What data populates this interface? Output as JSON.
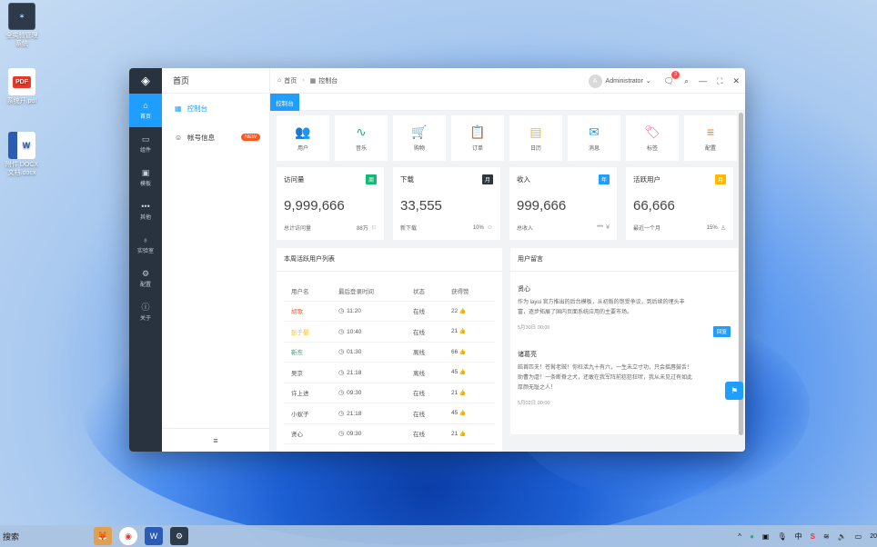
{
  "desktop": {
    "icons": [
      {
        "label_line1": "全实验管理",
        "label_line2": "系统",
        "badge": "✶"
      },
      {
        "label_line1": "系统开.pdf",
        "label_line2": "",
        "badge": "PDF"
      },
      {
        "label_line1": "附件 DOCX",
        "label_line2": "文档.docx",
        "badge": "W"
      }
    ]
  },
  "window": {
    "rail": [
      {
        "label": "首页",
        "icon": "home-icon",
        "glyph": "⌂",
        "active": true
      },
      {
        "label": "组件",
        "icon": "box-icon",
        "glyph": "▭"
      },
      {
        "label": "模板",
        "icon": "template-icon",
        "glyph": "▣"
      },
      {
        "label": "其他",
        "icon": "more-icon",
        "glyph": "•••"
      },
      {
        "label": "实验室",
        "icon": "flask-icon",
        "glyph": "♁"
      },
      {
        "label": "配置",
        "icon": "settings-icon",
        "glyph": "⚙"
      },
      {
        "label": "关于",
        "icon": "info-icon",
        "glyph": "ⓘ"
      }
    ],
    "sidebar": {
      "title": "首页",
      "items": [
        {
          "label": "控制台",
          "icon": "grid-icon",
          "glyph": "▦",
          "active": true
        },
        {
          "label": "帐号信息",
          "icon": "user-icon",
          "glyph": "☺",
          "badge": "NEW"
        }
      ],
      "collapse_glyph": "≡"
    },
    "breadcrumb": {
      "home": "首页",
      "current": "控制台"
    },
    "topbar": {
      "avatar_letter": "A",
      "username": "Administrator",
      "notify_count": "3"
    },
    "tabs": [
      {
        "label": "控制台",
        "active": true
      }
    ],
    "quick": [
      {
        "label": "用户",
        "icon": "users-icon",
        "glyph": "👥",
        "color": "#1e9fff"
      },
      {
        "label": "音乐",
        "icon": "pulse-icon",
        "glyph": "∿",
        "color": "#16b777"
      },
      {
        "label": "购物",
        "icon": "cart-icon",
        "glyph": "🛒",
        "color": "#ff5722"
      },
      {
        "label": "订单",
        "icon": "clipboard-icon",
        "glyph": "📋",
        "color": "#a38bdc"
      },
      {
        "label": "日历",
        "icon": "calendar-icon",
        "glyph": "▤",
        "color": "#ffb800"
      },
      {
        "label": "消息",
        "icon": "mail-icon",
        "glyph": "✉",
        "color": "#1e9fff"
      },
      {
        "label": "标签",
        "icon": "tag-icon",
        "glyph": "🏷",
        "color": "#e86fa3"
      },
      {
        "label": "配置",
        "icon": "sliders-icon",
        "glyph": "≡",
        "color": "#ff7d00"
      }
    ],
    "stats": [
      {
        "title": "访问量",
        "tag": "周",
        "tag_color": "#16b777",
        "value": "9,999,666",
        "foot_left": "总计访问量",
        "foot_right": "88万",
        "foot_icon": "flag-icon",
        "foot_glyph": "⚐"
      },
      {
        "title": "下载",
        "tag": "月",
        "tag_color": "#2f363c",
        "value": "33,555",
        "foot_left": "新下载",
        "foot_right": "10%",
        "foot_icon": "smile-icon",
        "foot_glyph": "☺"
      },
      {
        "title": "收入",
        "tag": "年",
        "tag_color": "#1e9fff",
        "value": "999,666",
        "foot_left": "总收入",
        "foot_right": "***",
        "foot_icon": "yen-icon",
        "foot_glyph": "¥"
      },
      {
        "title": "活跃用户",
        "tag": "月",
        "tag_color": "#ffb800",
        "value": "66,666",
        "foot_left": "最近一个月",
        "foot_right": "15%",
        "foot_icon": "person-icon",
        "foot_glyph": "♙"
      }
    ],
    "users_panel": {
      "title": "本周活跃用户列表",
      "headers": [
        "用户名",
        "最后登录时间",
        "状态",
        "获得赞"
      ],
      "rows": [
        {
          "name": "胡歌",
          "color": "#ff5722",
          "time": "11:20",
          "status": "在线",
          "likes": "22"
        },
        {
          "name": "彭于晏",
          "color": "#ffb800",
          "time": "10:40",
          "status": "在线",
          "likes": "21"
        },
        {
          "name": "靳东",
          "color": "#16b777",
          "time": "01:30",
          "status": "离线",
          "likes": "66"
        },
        {
          "name": "吴京",
          "color": "#555555",
          "time": "21:18",
          "status": "离线",
          "likes": "45"
        },
        {
          "name": "许上进",
          "color": "#555555",
          "time": "09:30",
          "status": "在线",
          "likes": "21"
        },
        {
          "name": "小蚁子",
          "color": "#555555",
          "time": "21:18",
          "status": "在线",
          "likes": "45"
        },
        {
          "name": "贤心",
          "color": "#555555",
          "time": "09:30",
          "status": "在线",
          "likes": "21"
        }
      ]
    },
    "messages_panel": {
      "title": "用户留言",
      "items": [
        {
          "name": "贤心",
          "line1": "作为 layui 官方推出的后台模板，从初版的饱受争议，到后续的埋头丰",
          "line2": "富，逐步拓展了国内页面系统应用的主要市场。",
          "time": "5月30日 00:00",
          "reply": "回复"
        },
        {
          "name": "诸葛亮",
          "line1": "皓首匹夫！苍髯老贼！你枉活九十有六，一生未立寸功，只会摇唇鼓舌！",
          "line2": "助曹为虐！一条断脊之犬，还敢在我军阵前狺狺狂吠，我从未见过有如此",
          "line3": "厚颜无耻之人！",
          "time": "5月02日 00:00"
        }
      ]
    }
  },
  "taskbar": {
    "search": "搜索",
    "tray": [
      "^",
      "中",
      "S"
    ],
    "clock": "20"
  }
}
